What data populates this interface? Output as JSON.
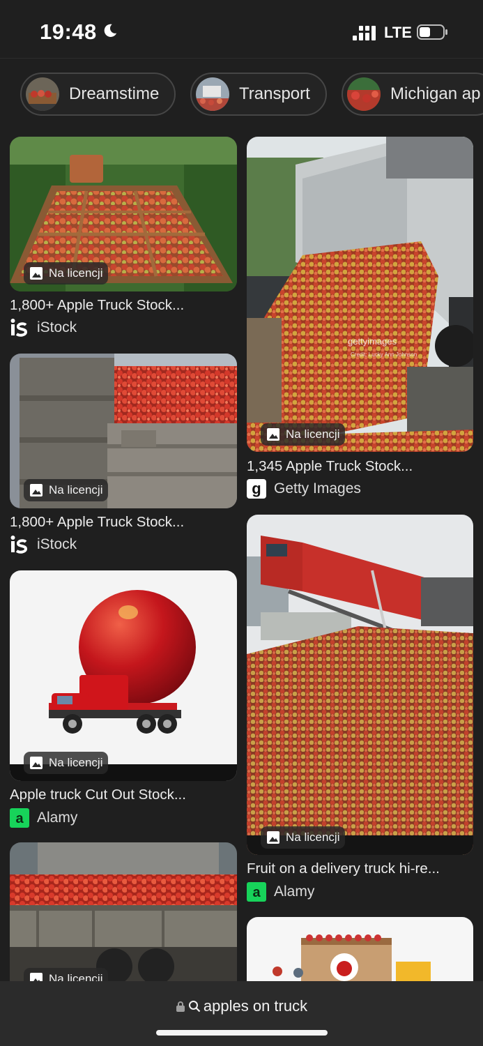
{
  "status_bar": {
    "time": "19:48",
    "network": "LTE"
  },
  "chips": [
    {
      "label": "Dreamstime"
    },
    {
      "label": "Transport"
    },
    {
      "label": "Michigan ap"
    }
  ],
  "results": {
    "badge_label": "Na licencji",
    "left_column": [
      {
        "title": "1,800+ Apple Truck Stock...",
        "source": "iStock",
        "source_icon": "istock-logo"
      },
      {
        "title": "1,800+ Apple Truck Stock...",
        "source": "iStock",
        "source_icon": "istock-logo"
      },
      {
        "title": "Apple truck Cut Out Stock...",
        "source": "Alamy",
        "source_icon": "alamy-logo"
      },
      {
        "title": "",
        "source": "",
        "source_icon": ""
      }
    ],
    "right_column": [
      {
        "title": "1,345 Apple Truck Stock...",
        "source": "Getty Images",
        "source_icon": "getty-logo",
        "watermark": "gettyimages",
        "credit": "Credit: Lucky Ann Johnson"
      },
      {
        "title": "Fruit on a delivery truck hi-re...",
        "source": "Alamy",
        "source_icon": "alamy-logo"
      },
      {
        "title": "",
        "source": "",
        "source_icon": ""
      }
    ]
  },
  "bottom_bar": {
    "url": "apples on truck"
  },
  "colors": {
    "background": "#1f1f1f",
    "bottom_bar": "#2b2b2b",
    "alamy_green": "#17d35a"
  }
}
